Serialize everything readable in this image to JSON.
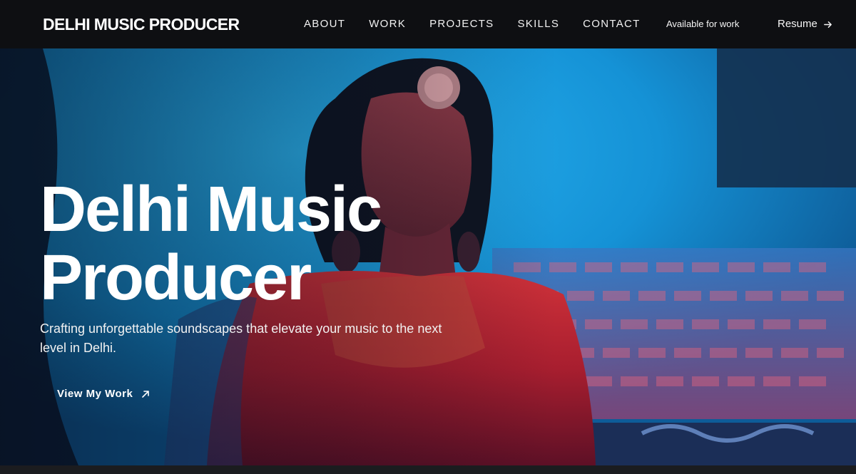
{
  "nav": {
    "brand": "DELHI MUSIC PRODUCER",
    "links": [
      {
        "label": "ABOUT"
      },
      {
        "label": "WORK"
      },
      {
        "label": "PROJECTS"
      },
      {
        "label": "SKILLS"
      },
      {
        "label": "CONTACT"
      }
    ],
    "availability": "Available for work",
    "resume_label": "Resume",
    "resume_icon": "arrow-right-icon"
  },
  "hero": {
    "title_line1": "Delhi Music",
    "title_line2": "Producer",
    "subtitle": "Crafting unforgettable soundscapes that elevate your music to the next level in Delhi.",
    "cta_label": "View My Work",
    "cta_icon": "arrow-up-right-icon",
    "background_image": "woman-in-red-under-blue-light-photo"
  },
  "colors": {
    "nav_bg": "#0e0f12",
    "text": "#ffffff",
    "hero_blue": "#1aa3e8",
    "hero_red": "#c8202c"
  }
}
